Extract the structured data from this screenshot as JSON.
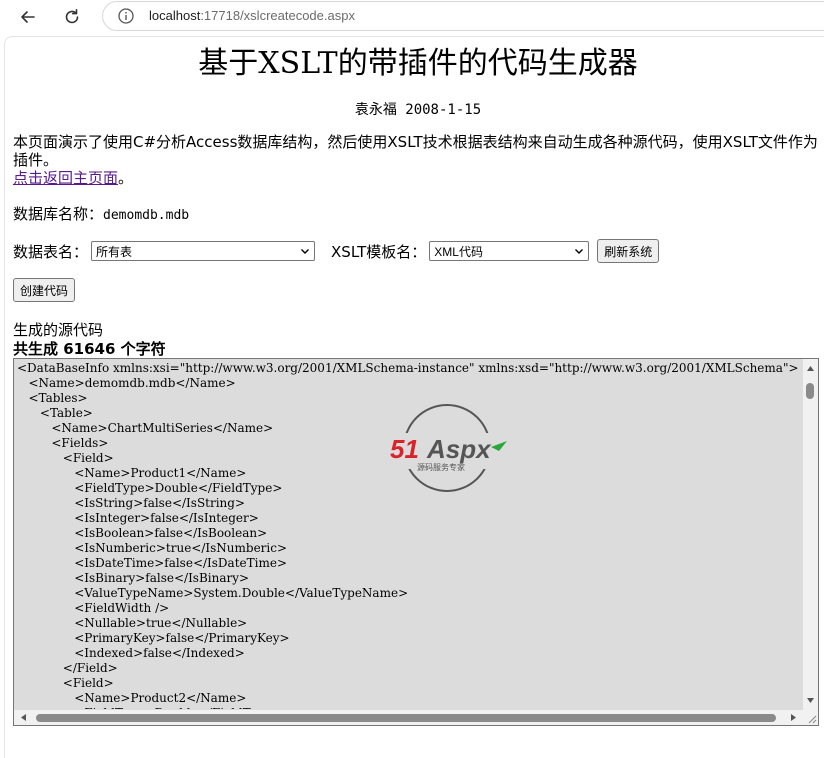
{
  "browser": {
    "url_host": "localhost",
    "url_path": ":17718/xslcreatecode.aspx"
  },
  "page": {
    "title": "基于XSLT的带插件的代码生成器",
    "author_line": "袁永福 2008-1-15",
    "intro_text": "本页面演示了使用C#分析Access数据库结构，然后使用XSLT技术根据表结构来自动生成各种源代码，使用XSLT文件作为插件。",
    "back_link": "点击返回主页面",
    "back_link_suffix": "。",
    "db_label": "数据库名称：",
    "db_value": "demomdb.mdb",
    "table_label": "数据表名：",
    "table_selected": "所有表",
    "xslt_label": "XSLT模板名：",
    "xslt_selected": "XML代码",
    "refresh_button": "刷新系统",
    "create_button": "创建代码",
    "generated_label": "生成的源代码",
    "generated_count": "共生成 61646 个字符"
  },
  "code_lines": [
    "<DataBaseInfo xmlns:xsi=\"http://www.w3.org/2001/XMLSchema-instance\" xmlns:xsd=\"http://www.w3.org/2001/XMLSchema\">",
    "   <Name>demomdb.mdb</Name>",
    "   <Tables>",
    "      <Table>",
    "         <Name>ChartMultiSeries</Name>",
    "         <Fields>",
    "            <Field>",
    "               <Name>Product1</Name>",
    "               <FieldType>Double</FieldType>",
    "               <IsString>false</IsString>",
    "               <IsInteger>false</IsInteger>",
    "               <IsBoolean>false</IsBoolean>",
    "               <IsNumberic>true</IsNumberic>",
    "               <IsDateTime>false</IsDateTime>",
    "               <IsBinary>false</IsBinary>",
    "               <ValueTypeName>System.Double</ValueTypeName>",
    "               <FieldWidth />",
    "               <Nullable>true</Nullable>",
    "               <PrimaryKey>false</PrimaryKey>",
    "               <Indexed>false</Indexed>",
    "            </Field>",
    "            <Field>",
    "               <Name>Product2</Name>",
    "               <FieldType>Double</FieldType>"
  ],
  "watermark": {
    "brand_red": "51",
    "brand_gray": "Aspx",
    "tagline": "源码服务专家",
    "colors": {
      "red": "#d9232a",
      "gray": "#555555",
      "green": "#2aa63a"
    }
  }
}
